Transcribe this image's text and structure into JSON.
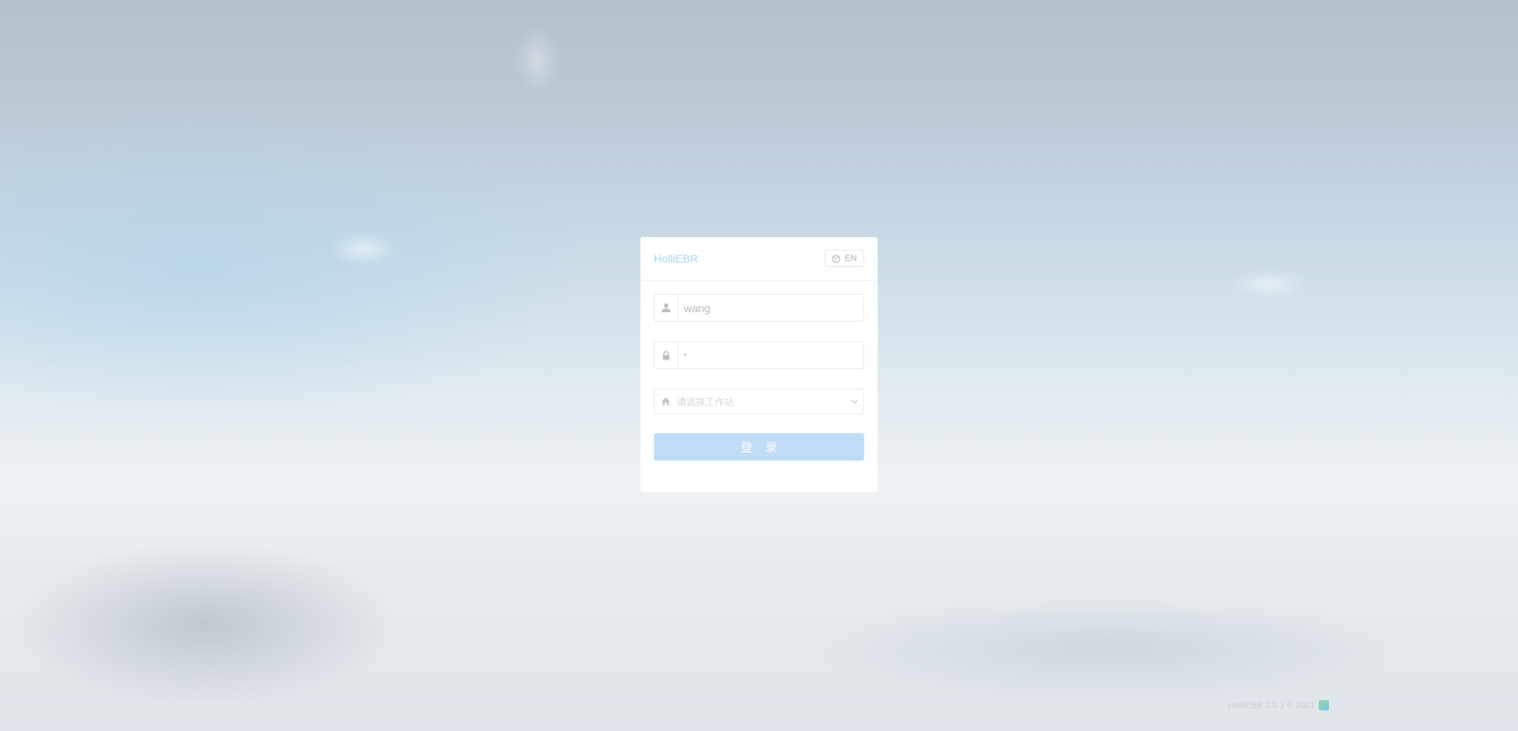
{
  "app": {
    "title": "HolliEBR",
    "language_button": "EN"
  },
  "form": {
    "username_value": "wang",
    "password_value": "•",
    "workstation_placeholder": "请选择工作站",
    "login_label": "登 录"
  },
  "footer": {
    "text": "HolliEBR 2.0.1 © 2021"
  },
  "icons": {
    "language": "globe-icon",
    "username": "user-icon",
    "password": "lock-icon",
    "workstation": "home-icon",
    "dropdown": "chevron-down-icon"
  },
  "colors": {
    "title": "#a8d3ee",
    "login_button": "#c1dcf6",
    "card": "#ffffff"
  }
}
